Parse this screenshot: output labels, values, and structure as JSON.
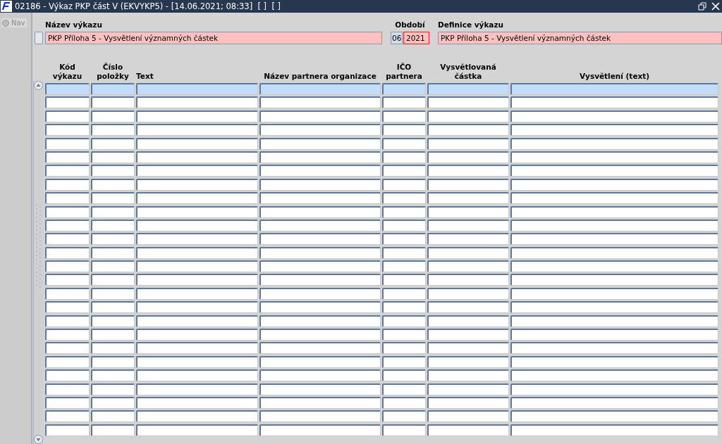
{
  "window": {
    "title": "02186 - Výkaz PKP část V (EKVYKP5) - [14.06.2021; 08:33]  [ ]  [ ]"
  },
  "nav": {
    "label": "Nav",
    "selected": false
  },
  "header": {
    "name_label": "Název výkazu",
    "name_value": "PKP Příloha 5 - Vysvětlení významných částek",
    "period_label": "Období",
    "period_month": "06",
    "period_year": "2021",
    "definition_label": "Definice výkazu",
    "definition_value": "PKP Příloha 5 - Vysvětlení významných částek"
  },
  "table": {
    "columns": [
      [
        "Kód",
        "výkazu"
      ],
      [
        "Číslo",
        "položky"
      ],
      [
        "Text"
      ],
      [
        "Název partnera organizace"
      ],
      [
        "IČO",
        "partnera"
      ],
      [
        "Vysvětlovaná",
        "částka"
      ],
      [
        "Vysvětlení (text)"
      ]
    ],
    "rows": [
      {
        "selected": true
      },
      {
        "selected": false
      },
      {
        "selected": false
      },
      {
        "selected": false
      },
      {
        "selected": false
      },
      {
        "selected": false
      },
      {
        "selected": false
      },
      {
        "selected": false
      },
      {
        "selected": false
      },
      {
        "selected": false
      },
      {
        "selected": false
      },
      {
        "selected": false
      },
      {
        "selected": false
      },
      {
        "selected": false
      },
      {
        "selected": false
      },
      {
        "selected": false
      },
      {
        "selected": false
      },
      {
        "selected": false
      },
      {
        "selected": false
      },
      {
        "selected": false
      },
      {
        "selected": false
      },
      {
        "selected": false
      },
      {
        "selected": false
      },
      {
        "selected": false
      },
      {
        "selected": false
      },
      {
        "selected": false
      }
    ]
  }
}
